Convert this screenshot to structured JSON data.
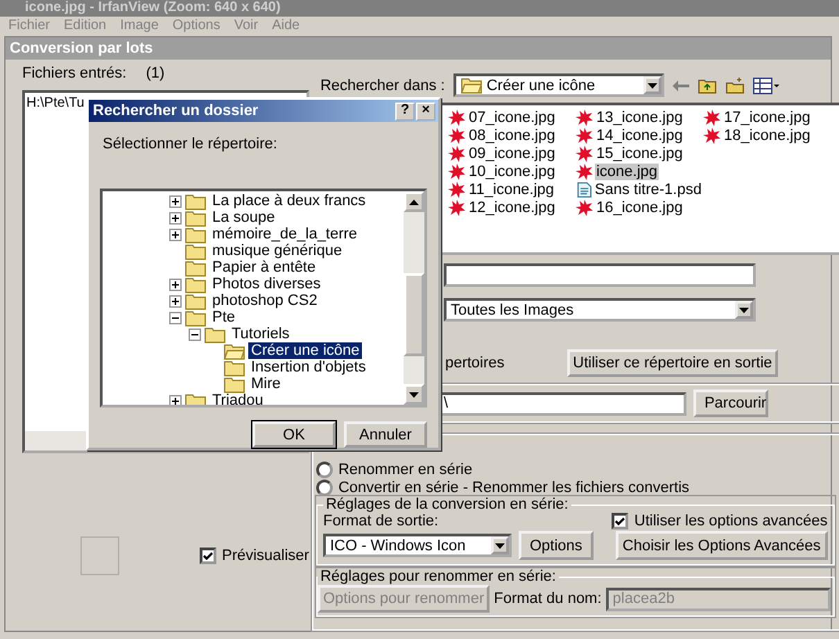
{
  "window": {
    "title": "icone.jpg - IrfanView (Zoom: 640 x 640)"
  },
  "menu": [
    "Fichier",
    "Edition",
    "Image",
    "Options",
    "Voir",
    "Aide"
  ],
  "panel_title": "Conversion par lots",
  "input_files": {
    "label": "Fichiers entrés:",
    "count": "(1)",
    "items": [
      "H:\\Pte\\Tu"
    ]
  },
  "preview": {
    "label": "Prévisualiser",
    "checked": true
  },
  "search": {
    "label": "Rechercher dans :",
    "value": "Créer une icône"
  },
  "files": [
    {
      "name": "07_icone.jpg",
      "kind": "image",
      "selected": false
    },
    {
      "name": "08_icone.jpg",
      "kind": "image",
      "selected": false
    },
    {
      "name": "09_icone.jpg",
      "kind": "image",
      "selected": false
    },
    {
      "name": "10_icone.jpg",
      "kind": "image",
      "selected": false
    },
    {
      "name": "11_icone.jpg",
      "kind": "image",
      "selected": false
    },
    {
      "name": "12_icone.jpg",
      "kind": "image",
      "selected": false
    },
    {
      "name": "13_icone.jpg",
      "kind": "image",
      "selected": false
    },
    {
      "name": "14_icone.jpg",
      "kind": "image",
      "selected": false
    },
    {
      "name": "15_icone.jpg",
      "kind": "image",
      "selected": false
    },
    {
      "name": "icone.jpg",
      "kind": "image",
      "selected": true
    },
    {
      "name": "Sans titre-1.psd",
      "kind": "psd",
      "selected": false
    },
    {
      "name": "16_icone.jpg",
      "kind": "image",
      "selected": false
    },
    {
      "name": "17_icone.jpg",
      "kind": "image",
      "selected": false
    },
    {
      "name": "18_icone.jpg",
      "kind": "image",
      "selected": false
    }
  ],
  "file_type": {
    "value": "Toutes les Images"
  },
  "subfolders_label": "pertoires",
  "use_as_output_button": "Utiliser ce répertoire en sortie",
  "output_dir": {
    "value": "\\",
    "browse_button": "Parcourir"
  },
  "modes": [
    {
      "label": "Renommer en série",
      "selected": false
    },
    {
      "label": "Convertir en série - Renommer les fichiers convertis",
      "selected": false
    }
  ],
  "conversion": {
    "title": "Réglages de la conversion en série:",
    "format_label": "Format de sortie:",
    "format": "ICO - Windows Icon",
    "options_button": "Options",
    "advanced": {
      "label": "Utiliser les options avancées",
      "checked": true
    },
    "advanced_button": "Choisir les Options Avancées"
  },
  "rename": {
    "title": "Réglages pour renommer en série:",
    "options_button": "Options pour renommer",
    "disabled": true,
    "name_format_label": "Format du nom:",
    "name_format": "placea2b"
  },
  "dialog": {
    "title": "Rechercher un dossier",
    "help": "?",
    "close": "×",
    "prompt": "Sélectionner le répertoire:",
    "tree": [
      {
        "label": "La place à deux francs",
        "expanded": false,
        "selected": false
      },
      {
        "label": "La soupe",
        "expanded": false,
        "selected": false
      },
      {
        "label": "mémoire_de_la_terre",
        "expanded": false,
        "selected": false
      },
      {
        "label": "musique générique",
        "selected": false
      },
      {
        "label": "Papier à entête",
        "selected": false
      },
      {
        "label": "Photos diverses",
        "expanded": false,
        "selected": false
      },
      {
        "label": "photoshop CS2",
        "expanded": false,
        "selected": false
      },
      {
        "label": "Pte",
        "expanded": true,
        "selected": false,
        "children": [
          {
            "label": "Tutoriels",
            "expanded": true,
            "selected": false,
            "children": [
              {
                "label": "Créer une icône",
                "selected": true
              },
              {
                "label": "Insertion d'objets",
                "selected": false
              },
              {
                "label": "Mire",
                "selected": false
              }
            ]
          }
        ]
      },
      {
        "label": "Triadou",
        "expanded": false,
        "selected": false
      }
    ],
    "buttons": [
      "OK",
      "Annuler"
    ]
  }
}
